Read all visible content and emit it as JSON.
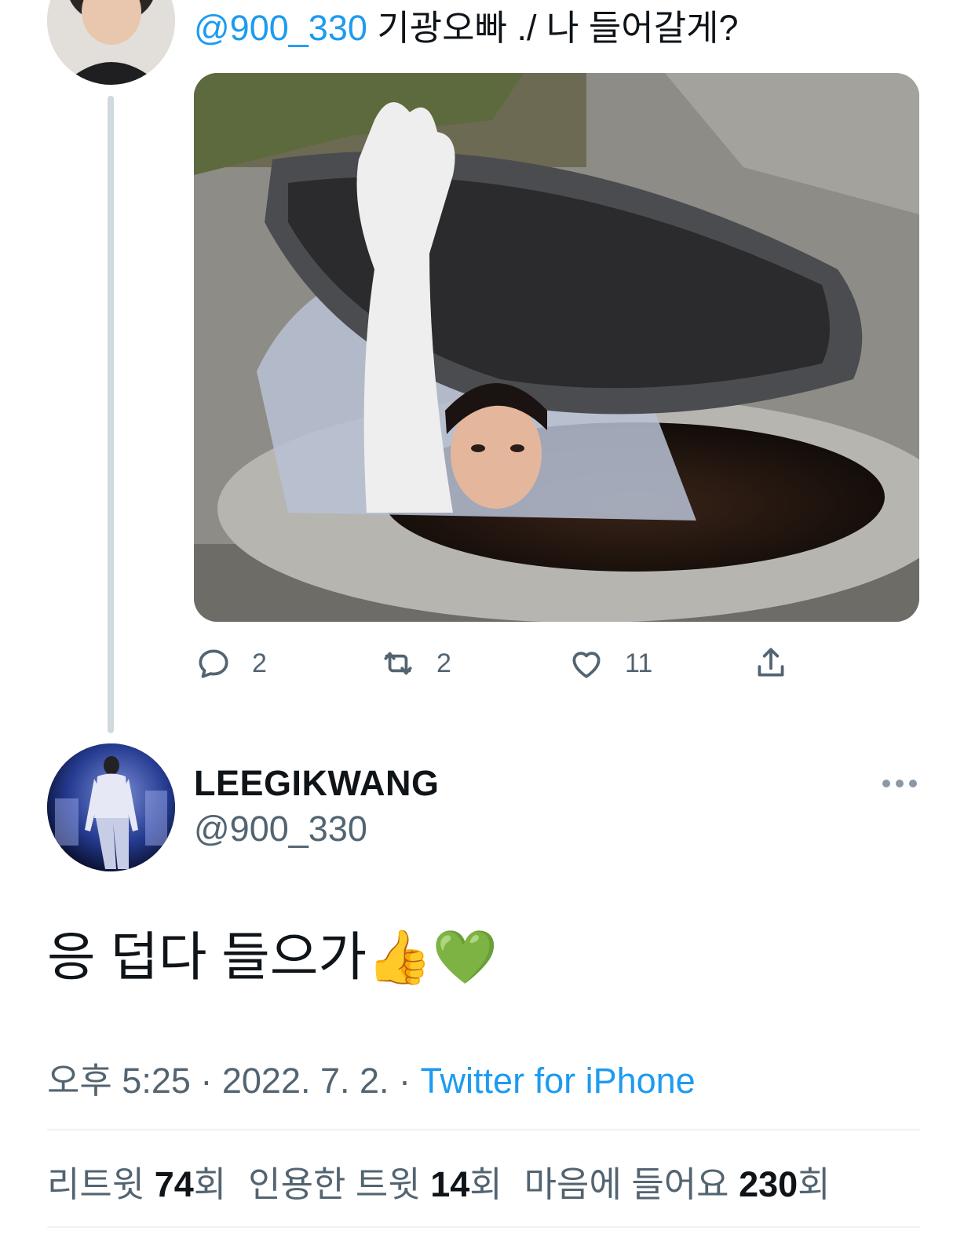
{
  "parent_tweet": {
    "mention": "@900_330",
    "text": " 기광오빠 ./ 나 들어갈게?",
    "actions": {
      "reply_count": "2",
      "retweet_count": "2",
      "like_count": "11"
    }
  },
  "main_tweet": {
    "display_name": "LEEGIKWANG",
    "handle": "@900_330",
    "text": "응 덥다 들으가👍💚",
    "time": "오후 5:25 · 2022. 7. 2. · ",
    "source": "Twitter for iPhone",
    "stats": {
      "retweets_label": "리트윗 ",
      "retweets": "74",
      "retweets_unit": "회",
      "quotes_label": "인용한 트윗 ",
      "quotes": "14",
      "quotes_unit": "회",
      "likes_label": "마음에 들어요 ",
      "likes": "230",
      "likes_unit": "회"
    }
  },
  "icons": {
    "reply": "reply-icon",
    "retweet": "retweet-icon",
    "like": "heart-icon",
    "share": "share-icon",
    "more": "more-icon"
  },
  "colors": {
    "link": "#1d9bf0",
    "secondary_text": "#536471",
    "primary_text": "#0f1419",
    "thread_line": "#cfd9de"
  }
}
